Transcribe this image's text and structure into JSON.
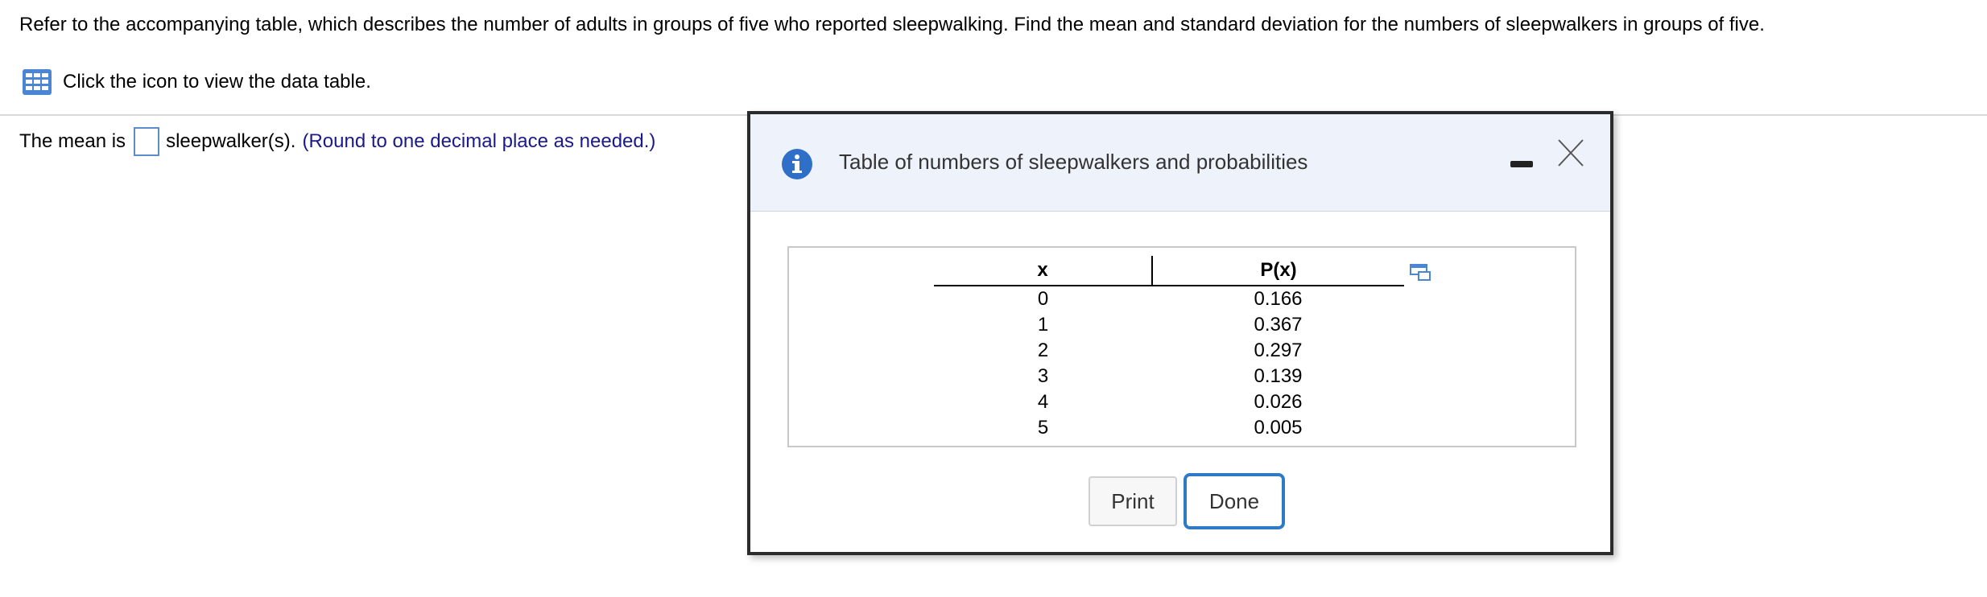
{
  "question": {
    "text": "Refer to the accompanying table, which describes the number of adults in groups of five who reported sleepwalking. Find the mean and standard deviation for the numbers of sleepwalkers in groups of five."
  },
  "data_link": {
    "label": "Click the icon to view the data table."
  },
  "answer": {
    "prefix": "The mean is",
    "value": "",
    "suffix": "sleepwalker(s).",
    "hint": "(Round to one decimal place as needed.)"
  },
  "dialog": {
    "title": "Table of numbers of sleepwalkers and probabilities",
    "table": {
      "headers": [
        "x",
        "P(x)"
      ],
      "rows": [
        [
          "0",
          "0.166"
        ],
        [
          "1",
          "0.367"
        ],
        [
          "2",
          "0.297"
        ],
        [
          "3",
          "0.139"
        ],
        [
          "4",
          "0.026"
        ],
        [
          "5",
          "0.005"
        ]
      ]
    },
    "print_label": "Print",
    "done_label": "Done"
  },
  "colors": {
    "accent": "#2f7ac6",
    "header_bg": "#eef3fb",
    "hint_text": "#1a1a8c"
  },
  "icons": [
    "data-table-icon",
    "info-icon",
    "minimize-icon",
    "close-icon",
    "popout-icon"
  ]
}
